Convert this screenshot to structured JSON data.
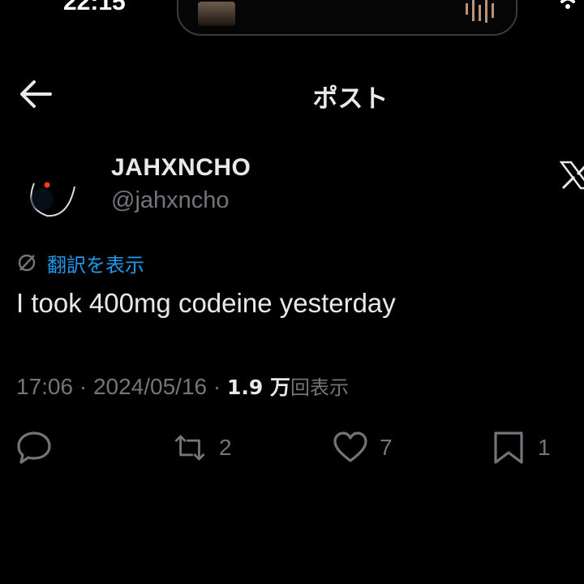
{
  "status_bar": {
    "time": "22:15"
  },
  "header": {
    "title": "ポスト"
  },
  "user": {
    "display_name": "JAHXNCHO",
    "handle": "@jahxncho"
  },
  "translate": {
    "label": "翻訳を表示"
  },
  "tweet": {
    "text": "I took 400mg codeine yesterday"
  },
  "meta": {
    "time": "17:06",
    "separator": "·",
    "date": "2024/05/16",
    "views_count": "1.9 万",
    "views_label": "回表示"
  },
  "actions": {
    "reply_icon": "reply-icon",
    "retweet_icon": "retweet-icon",
    "retweet_count": "2",
    "like_icon": "heart-icon",
    "like_count": "7",
    "bookmark_icon": "bookmark-icon",
    "bookmark_count": "1"
  },
  "colors": {
    "background": "#000000",
    "text_primary": "#e7e9ea",
    "text_secondary": "#71767b",
    "link": "#1d9bf0"
  }
}
